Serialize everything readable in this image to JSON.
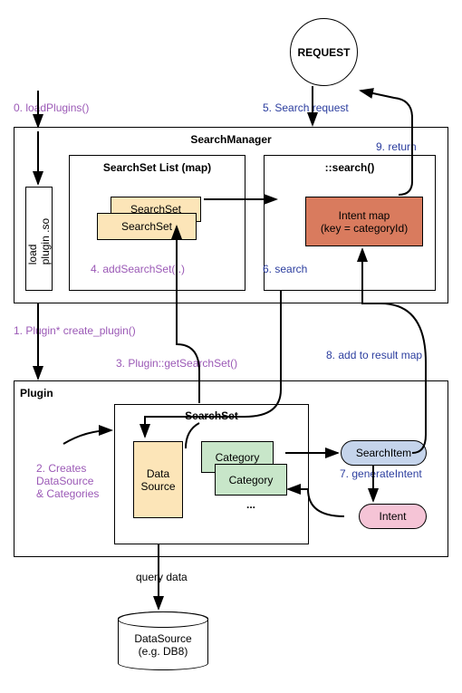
{
  "request": "REQUEST",
  "searchManager": {
    "title": "SearchManager",
    "searchSetList": {
      "title": "SearchSet List (map)",
      "item1": "SearchSet",
      "item2": "SearchSet"
    },
    "search": {
      "title": "::search()",
      "intentMap1": "Intent map",
      "intentMap2": "(key = categoryId)"
    },
    "loadPluginSo": "load plugin .so"
  },
  "plugin": {
    "title": "Plugin",
    "searchSet": {
      "title": "SearchSet",
      "dataSource": "Data Source",
      "category1": "Category",
      "category2": "Category",
      "ellipsis": "..."
    },
    "searchItem": "SearchItem",
    "intent": "Intent"
  },
  "datasourceCylinder1": "DataSource",
  "datasourceCylinder2": "(e.g. DB8)",
  "labels": {
    "step0": "0. loadPlugins()",
    "step1": "1. Plugin* create_plugin()",
    "step2a": "2. Creates",
    "step2b": "DataSource",
    "step2c": "& Categories",
    "step3": "3. Plugin::getSearchSet()",
    "step4": "4. addSearchSet(..)",
    "step5": "5. Search request",
    "step6": "6. search",
    "step7": "7. generateIntent",
    "step8": "8. add to result map",
    "step9": "9. return",
    "queryData": "query data"
  }
}
